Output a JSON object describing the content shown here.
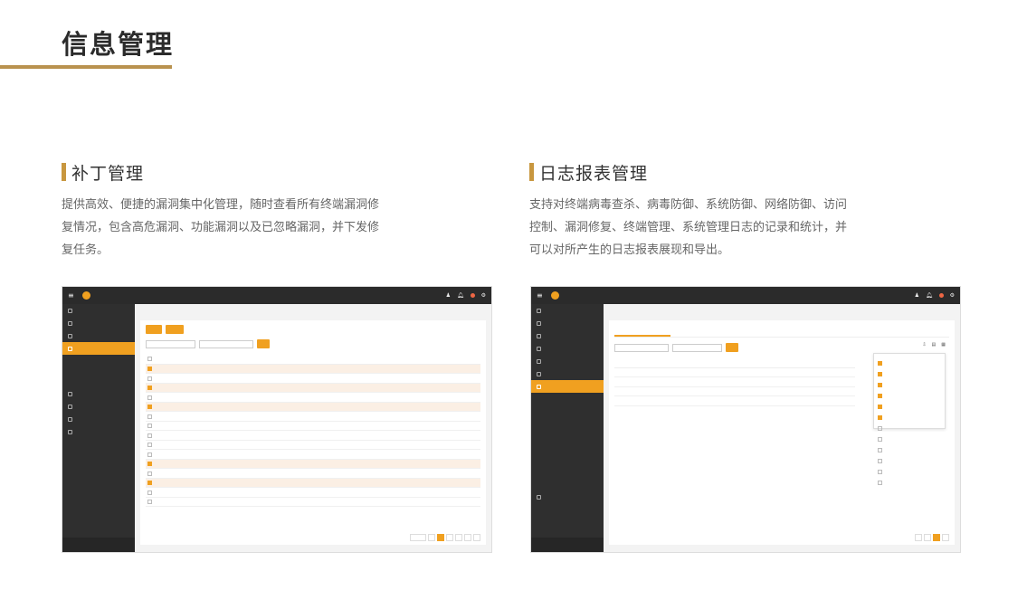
{
  "page": {
    "title": "信息管理"
  },
  "sections": {
    "patch": {
      "title": "补丁管理",
      "desc": "提供高效、便捷的漏洞集中化管理，随时查看所有终端漏洞修复情况，包含高危漏洞、功能漏洞以及已忽略漏洞，并下发修复任务。"
    },
    "log": {
      "title": "日志报表管理",
      "desc": "支持对终端病毒查杀、病毒防御、系统防御、网络防御、访问控制、漏洞修复、终端管理、系统管理日志的记录和统计，并可以对所产生的日志报表展现和导出。"
    }
  },
  "colors": {
    "accent": "#c8973f",
    "orange": "#f0a020",
    "dark": "#2b2b2b"
  }
}
